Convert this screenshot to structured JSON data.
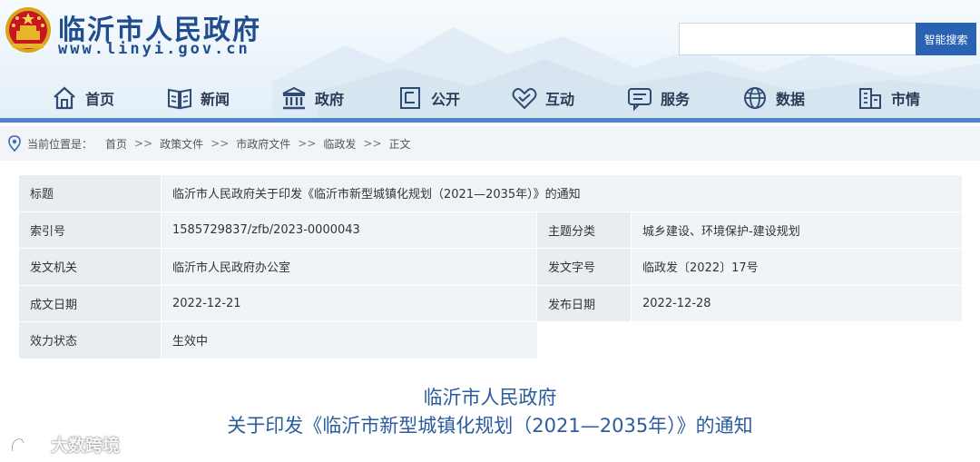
{
  "header": {
    "site_title": "临沂市人民政府",
    "site_url": "www.linyi.gov.cn",
    "search": {
      "placeholder": "",
      "button_label": "智能搜索"
    }
  },
  "nav": {
    "items": [
      {
        "label": "首页",
        "icon": "home-icon"
      },
      {
        "label": "新闻",
        "icon": "news-icon"
      },
      {
        "label": "政府",
        "icon": "government-building-icon"
      },
      {
        "label": "公开",
        "icon": "document-icon"
      },
      {
        "label": "互动",
        "icon": "handshake-icon"
      },
      {
        "label": "服务",
        "icon": "service-chat-icon"
      },
      {
        "label": "数据",
        "icon": "data-globe-icon"
      },
      {
        "label": "市情",
        "icon": "city-building-icon"
      }
    ]
  },
  "breadcrumb": {
    "prefix": "当前位置是：",
    "items": [
      "首页",
      "政策文件",
      "市政府文件",
      "临政发"
    ],
    "separator": ">>",
    "current": "正文"
  },
  "info": {
    "title_label": "标题",
    "title_value": "临沂市人民政府关于印发《临沂市新型城镇化规划（2021—2035年）》的通知",
    "index_label": "索引号",
    "index_value": "1585729837/zfb/2023-0000043",
    "topic_label": "主题分类",
    "topic_value": "城乡建设、环境保护-建设规划",
    "issuer_label": "发文机关",
    "issuer_value": "临沂市人民政府办公室",
    "docno_label": "发文字号",
    "docno_value": "临政发〔2022〕17号",
    "created_label": "成文日期",
    "created_value": "2022-12-21",
    "published_label": "发布日期",
    "published_value": "2022-12-28",
    "status_label": "效力状态",
    "status_value": "生效中"
  },
  "document": {
    "title_line1": "临沂市人民政府",
    "title_line2": "关于印发《临沂市新型城镇化规划（2021—2035年）》的通知"
  },
  "watermark": {
    "text": "大数跨境"
  },
  "colors": {
    "brand_blue": "#1f4d8f",
    "accent_blue": "#2a62b3",
    "nav_bar": "#4a86c8",
    "doc_title": "#2b5c9e"
  }
}
